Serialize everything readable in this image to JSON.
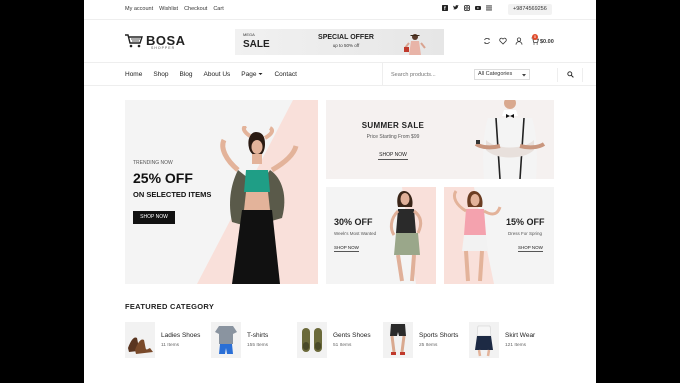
{
  "topbar": {
    "links": [
      "My account",
      "Wishlist",
      "Checkout",
      "Cart"
    ],
    "socials": [
      "facebook-icon",
      "twitter-icon",
      "instagram-icon",
      "youtube-icon",
      "menu-icon"
    ],
    "phone": "+9874569256"
  },
  "header": {
    "logo_text": "BOSA",
    "logo_sub": "SHOPPER",
    "banner": {
      "mega": "MEGA",
      "sale": "SALE",
      "offer": "SPECIAL OFFER",
      "sub": "up to 50% off"
    },
    "cart_count": "0",
    "cart_total": "$0.00"
  },
  "nav": {
    "links": [
      "Home",
      "Shop",
      "Blog",
      "About Us",
      "Page",
      "Contact"
    ],
    "search_placeholder": "Search products...",
    "category_select": "All Categories"
  },
  "hero": {
    "trending": "TRENDING NOW",
    "pct": "25% OFF",
    "selected": "ON SELECTED ITEMS",
    "button": "SHOP NOW"
  },
  "summer": {
    "title": "SUMMER SALE",
    "price": "Price Starting From $99",
    "button": "SHOP NOW"
  },
  "cards": [
    {
      "pct": "30% OFF",
      "sub": "Week's Most Wanted",
      "button": "SHOP NOW"
    },
    {
      "pct": "15% OFF",
      "sub": "Dress For Spring",
      "button": "SHOP NOW"
    }
  ],
  "featured": {
    "title": "FEATURED CATEGORY",
    "items": [
      {
        "name": "Ladies Shoes",
        "count": "11 Items"
      },
      {
        "name": "T-shirts",
        "count": "155 Items"
      },
      {
        "name": "Gents Shoes",
        "count": "51 Items"
      },
      {
        "name": "Sports Shorts",
        "count": "25 Items"
      },
      {
        "name": "Skirt Wear",
        "count": "121 Items"
      }
    ]
  },
  "colors": {
    "accent_pink": "#f9e0da",
    "badge": "#e04a2a",
    "dark": "#111111"
  }
}
